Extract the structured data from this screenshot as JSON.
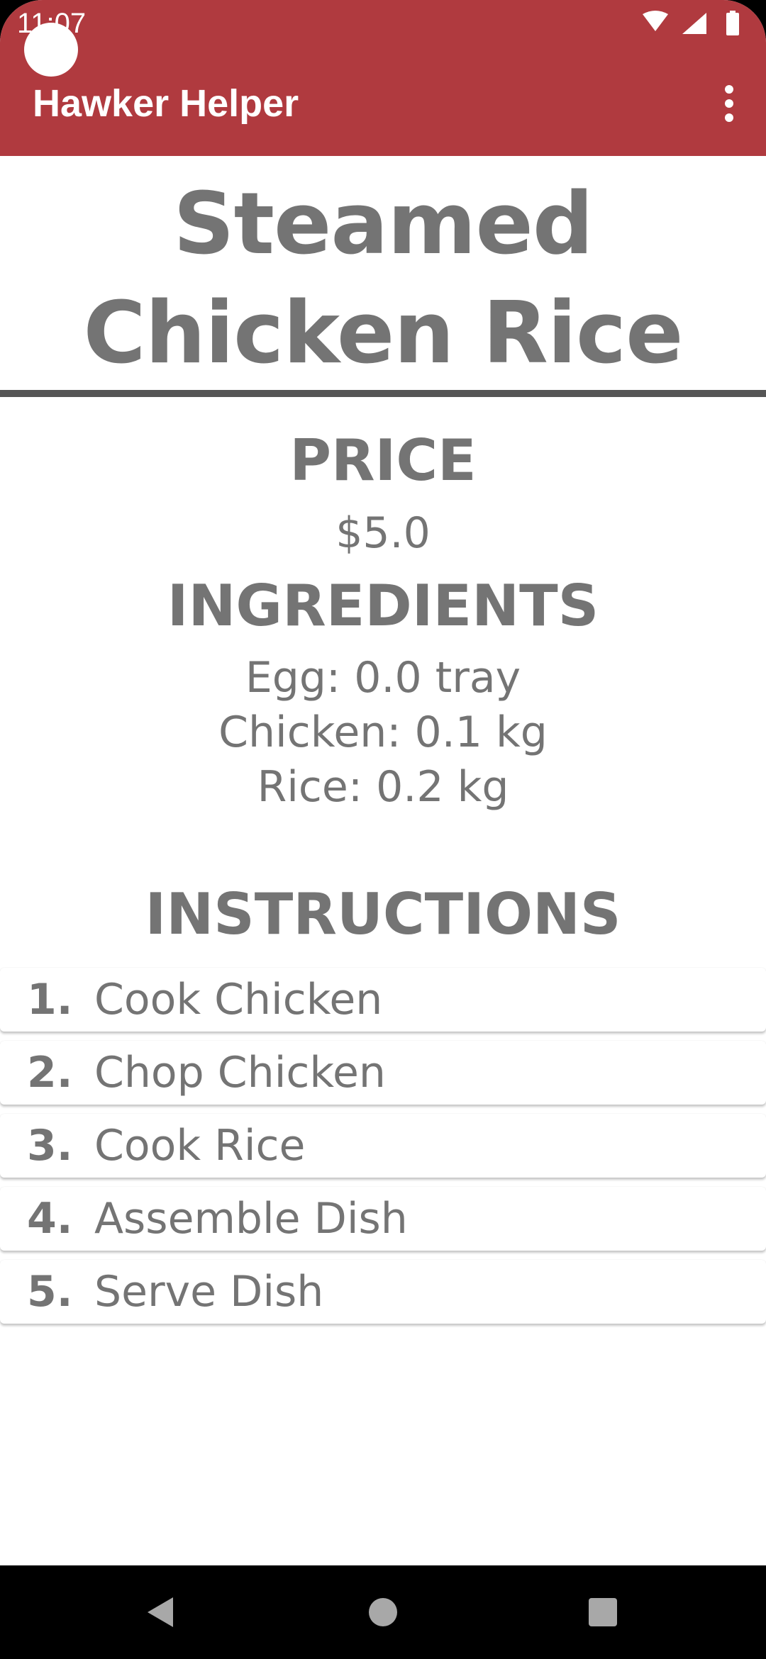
{
  "status_bar": {
    "time": "11:07",
    "icons": [
      "wifi-icon",
      "signal-icon",
      "battery-icon"
    ]
  },
  "app_bar": {
    "title": "Hawker Helper",
    "menu_icon": "more-vert-icon",
    "color": "#b03a3f"
  },
  "dish": {
    "name": "Steamed Chicken Rice"
  },
  "price": {
    "heading": "PRICE",
    "value": "$5.0"
  },
  "ingredients": {
    "heading": "INGREDIENTS",
    "items": [
      "Egg: 0.0 tray",
      "Chicken: 0.1 kg",
      "Rice: 0.2 kg"
    ]
  },
  "instructions": {
    "heading": "INSTRUCTIONS",
    "steps": [
      {
        "number": "1.",
        "text": "Cook Chicken"
      },
      {
        "number": "2.",
        "text": "Chop Chicken"
      },
      {
        "number": "3.",
        "text": "Cook Rice"
      },
      {
        "number": "4.",
        "text": "Assemble Dish"
      },
      {
        "number": "5.",
        "text": "Serve Dish"
      }
    ]
  },
  "nav_bar": {
    "buttons": [
      "back-icon",
      "home-icon",
      "recents-icon"
    ]
  },
  "colors": {
    "text_gray": "#747474",
    "divider": "#555555"
  }
}
